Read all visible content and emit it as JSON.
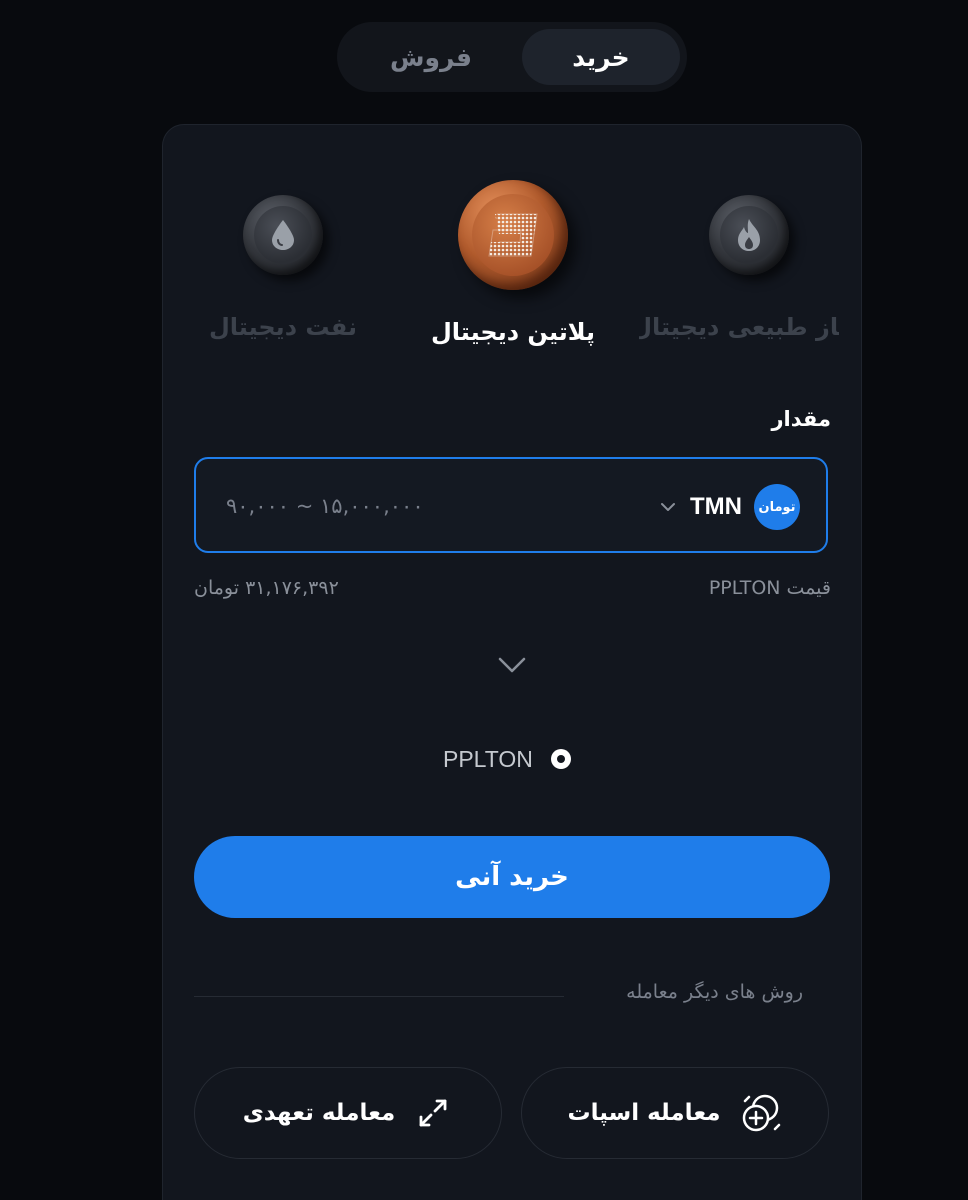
{
  "tabs": {
    "buy_label": "خرید",
    "sell_label": "فروش",
    "active": "buy"
  },
  "coins": [
    {
      "label": "نفت دیجیتال",
      "icon": "oil-drop-icon",
      "active": false
    },
    {
      "label": "پلاتین دیجیتال",
      "icon": "platinum-logo-icon",
      "active": true
    },
    {
      "label": "گاز طبیعی دیجیتال",
      "icon": "gas-flame-icon",
      "active": false
    }
  ],
  "amount": {
    "label": "مقدار",
    "value": "",
    "placeholder": "۹۰,۰۰۰ ~ ۱۵,۰۰۰,۰۰۰",
    "currency_code": "TMN",
    "currency_badge": "تومان"
  },
  "price": {
    "label": "قیمت PPLTON",
    "value": "۳۱,۱۷۶,۳۹۲ تومان"
  },
  "output": {
    "asset": "PPLTON"
  },
  "buy_button_label": "خرید آنی",
  "other_methods_label": "روش های دیگر معامله",
  "methods": {
    "spot_label": "معامله اسپات",
    "margin_label": "معامله تعهدی"
  },
  "colors": {
    "accent": "#1f7dea",
    "background": "#080a0e",
    "card": "#12161e"
  }
}
